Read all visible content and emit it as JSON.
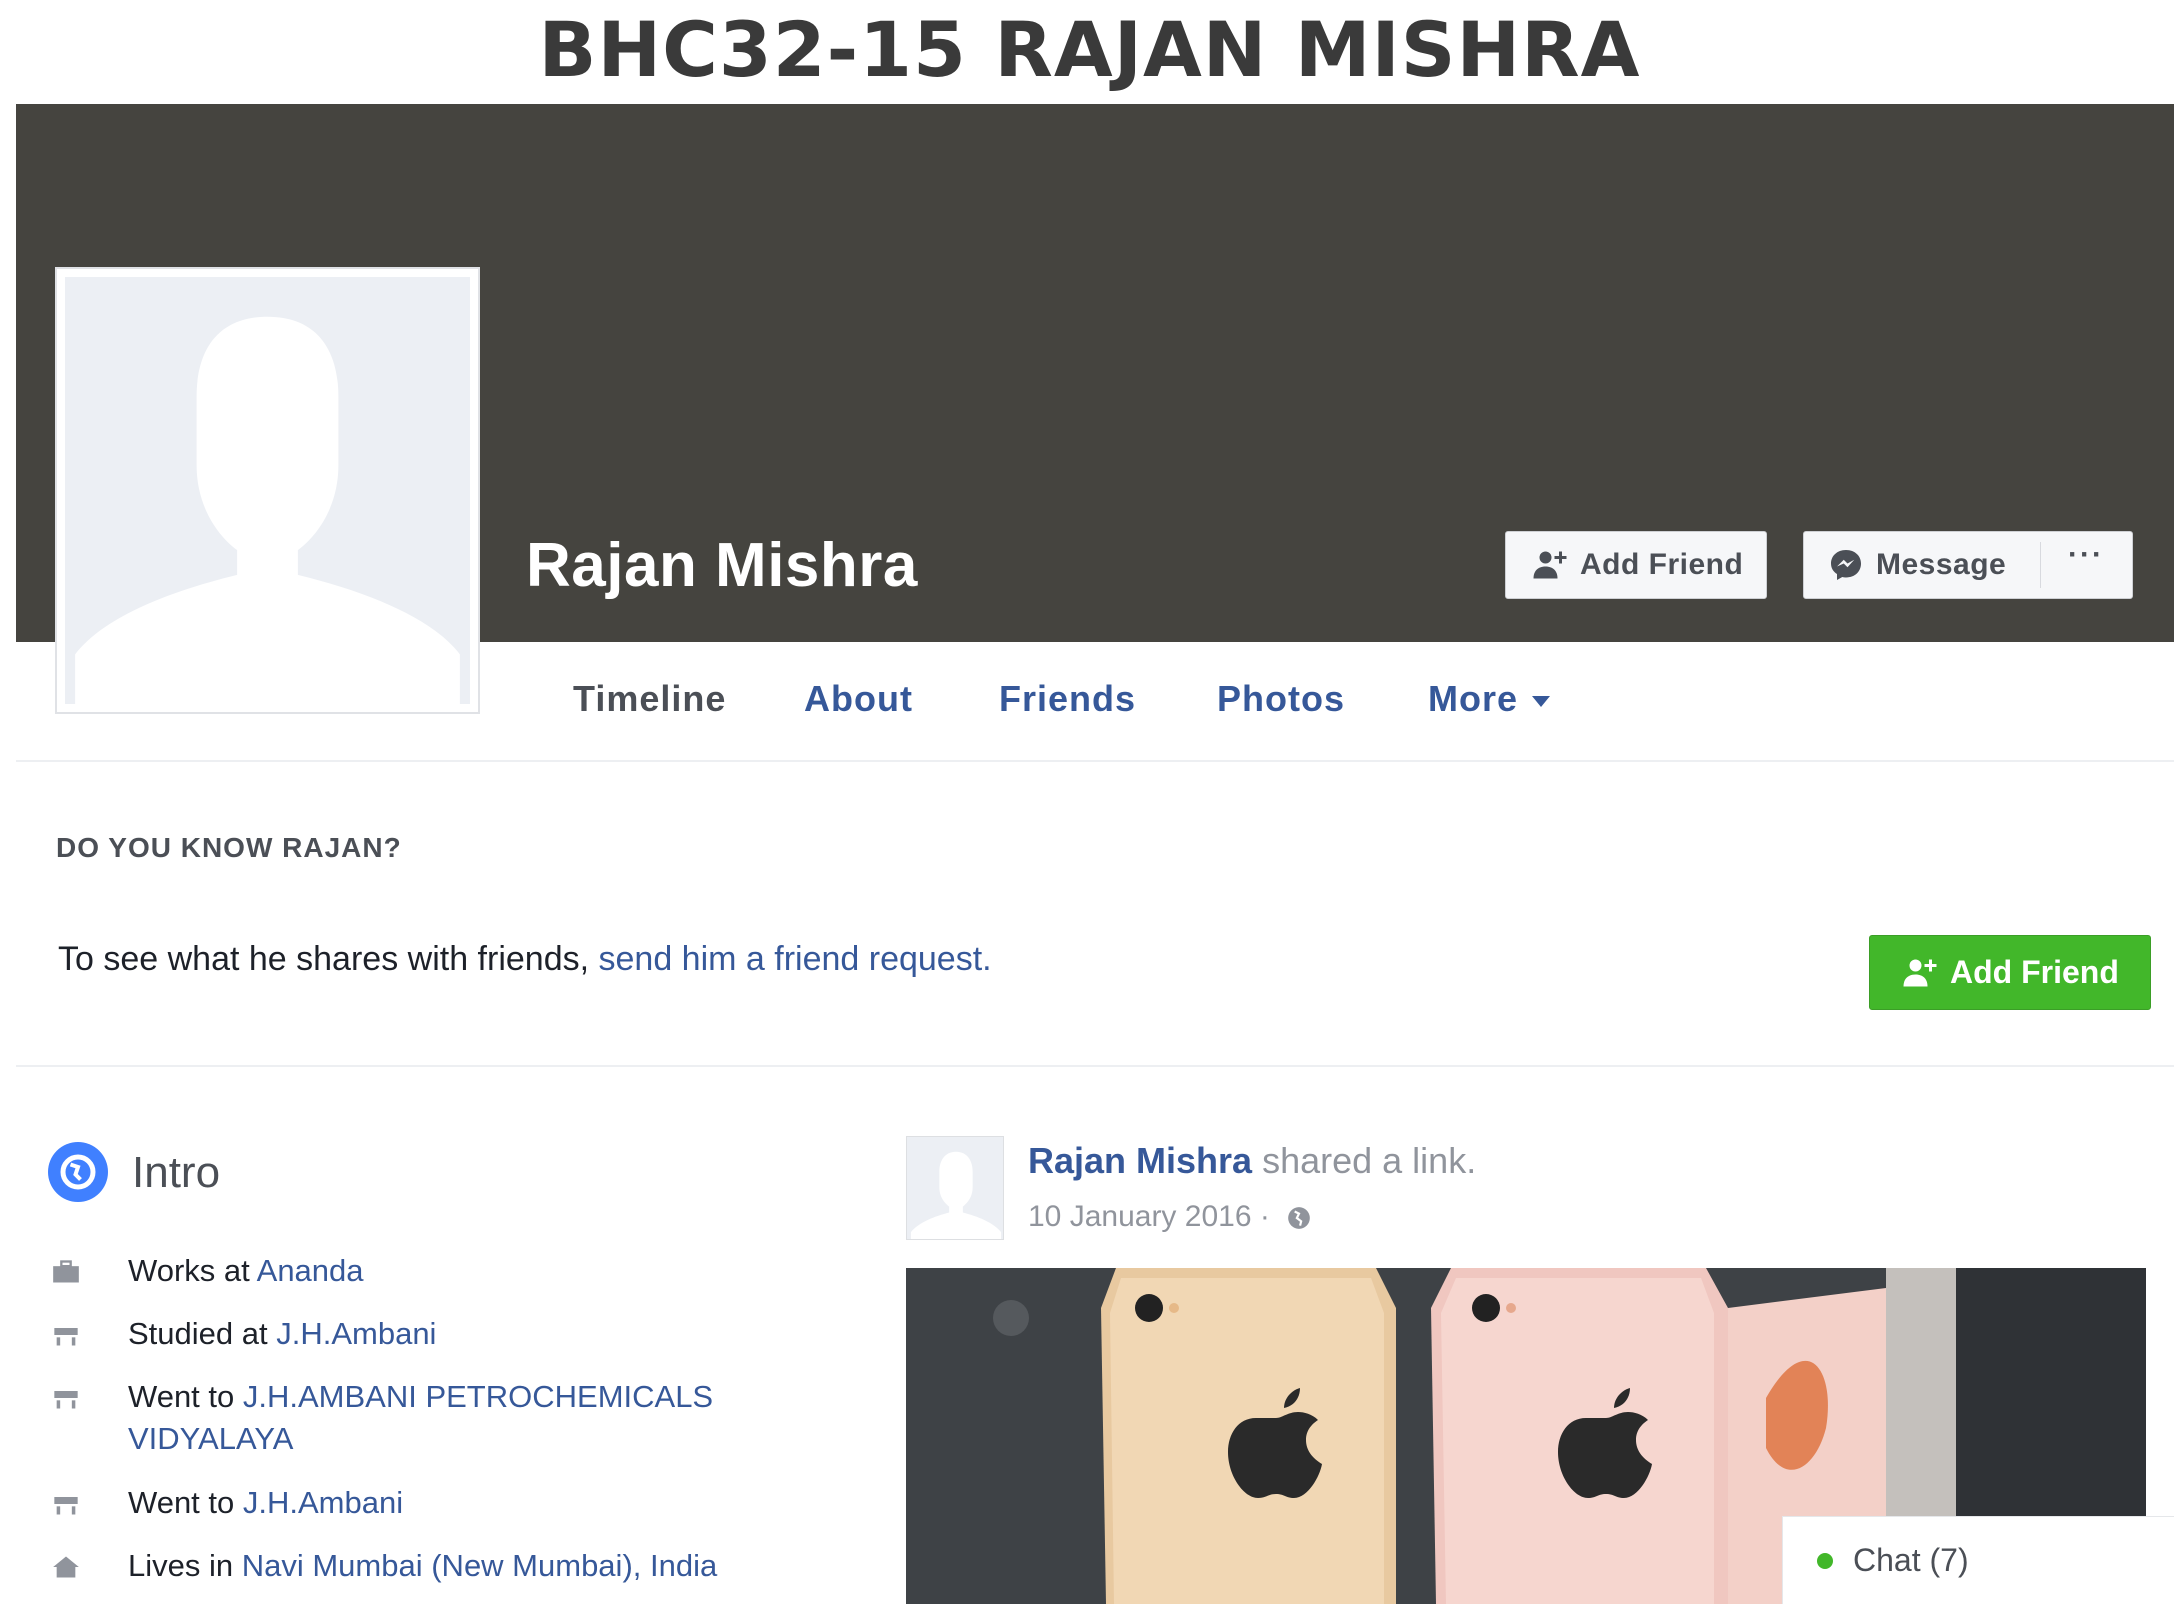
{
  "document": {
    "header": "BHC32-15 RAJAN MISHRA"
  },
  "profile": {
    "name": "Rajan Mishra",
    "add_friend_label": "Add Friend",
    "message_label": "Message",
    "more_dots": "···"
  },
  "tabs": [
    {
      "label": "Timeline",
      "active": true
    },
    {
      "label": "About"
    },
    {
      "label": "Friends"
    },
    {
      "label": "Photos"
    },
    {
      "label": "More"
    }
  ],
  "know": {
    "title": "DO YOU KNOW RAJAN?",
    "text": "To see what he shares with friends, ",
    "link": "send him a friend request.",
    "button_label": "Add Friend"
  },
  "intro": {
    "title": "Intro",
    "items": [
      {
        "icon": "briefcase-icon",
        "prefix": "Works at ",
        "link": "Ananda"
      },
      {
        "icon": "school-icon",
        "prefix": "Studied at ",
        "link": "J.H.Ambani"
      },
      {
        "icon": "school-icon",
        "prefix": "Went to ",
        "link": "J.H.AMBANI PETROCHEMICALS VIDYALAYA"
      },
      {
        "icon": "school-icon",
        "prefix": "Went to ",
        "link": "J.H.Ambani"
      },
      {
        "icon": "home-icon",
        "prefix": "Lives in ",
        "link": "Navi Mumbai (New Mumbai), India"
      }
    ]
  },
  "post": {
    "author": "Rajan Mishra",
    "action": " shared a link.",
    "date": "10 January 2016 ·"
  },
  "chat": {
    "label": "Chat (7)"
  },
  "colors": {
    "cover": "#45443f",
    "link": "#365899",
    "green": "#42b72a",
    "intro_icon": "#4080ff"
  }
}
